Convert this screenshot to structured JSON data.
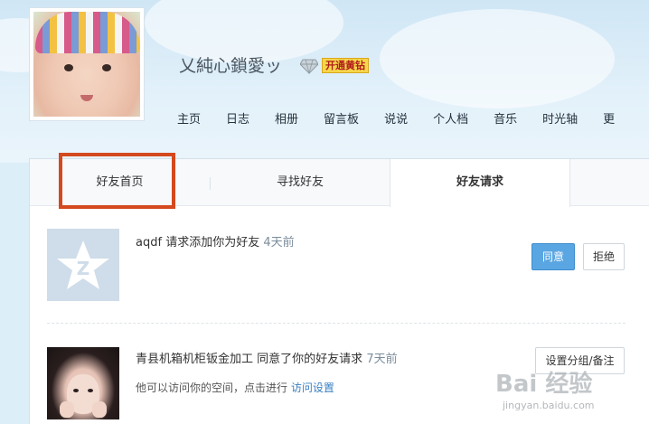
{
  "profile": {
    "nickname": "乂純心鎖愛ッ",
    "vip_badge": "开通黄钻"
  },
  "nav": {
    "items": [
      "主页",
      "日志",
      "相册",
      "留言板",
      "说说",
      "个人档",
      "音乐",
      "时光轴",
      "更"
    ]
  },
  "tabs": {
    "home": "好友首页",
    "find": "寻找好友",
    "requests": "好友请求"
  },
  "requests": [
    {
      "name": "aqdf",
      "message": "请求添加你为好友",
      "time": "4天前",
      "agree_label": "同意",
      "reject_label": "拒绝"
    },
    {
      "name": "青县机箱机柜钣金加工",
      "message": "同意了你的好友请求",
      "time": "7天前",
      "sub_text": "他可以访问你的空间，点击进行",
      "sub_link": "访问设置",
      "group_label": "设置分组/备注"
    }
  ],
  "watermark": {
    "brand": "Bai 经验",
    "url": "jingyan.baidu.com"
  },
  "colors": {
    "accent": "#5aa6e2",
    "highlight": "#d4491f",
    "link": "#3a7fc1"
  }
}
